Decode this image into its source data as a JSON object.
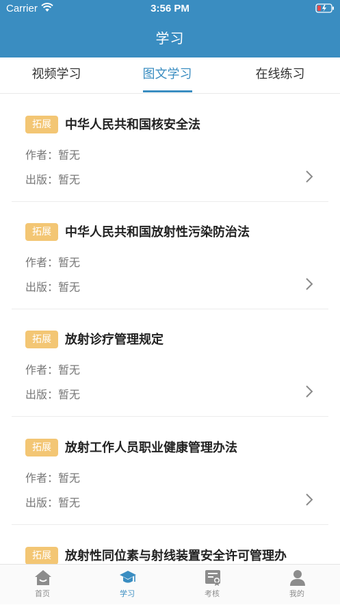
{
  "status_bar": {
    "carrier": "Carrier",
    "time": "3:56 PM"
  },
  "header": {
    "title": "学习"
  },
  "tabs": [
    {
      "label": "视频学习",
      "active": false
    },
    {
      "label": "图文学习",
      "active": true
    },
    {
      "label": "在线练习",
      "active": false
    }
  ],
  "items": [
    {
      "badge": "拓展",
      "title": "中华人民共和国核安全法",
      "author": "作者：暂无",
      "publisher": "出版：暂无"
    },
    {
      "badge": "拓展",
      "title": "中华人民共和国放射性污染防治法",
      "author": "作者：暂无",
      "publisher": "出版：暂无"
    },
    {
      "badge": "拓展",
      "title": "放射诊疗管理规定",
      "author": "作者：暂无",
      "publisher": "出版：暂无"
    },
    {
      "badge": "拓展",
      "title": "放射工作人员职业健康管理办法",
      "author": "作者：暂无",
      "publisher": "出版：暂无"
    },
    {
      "badge": "拓展",
      "title": "放射性同位素与射线装置安全许可管理办",
      "author": "",
      "publisher": ""
    }
  ],
  "tabbar": [
    {
      "label": "首页",
      "icon": "home-icon",
      "active": false
    },
    {
      "label": "学习",
      "icon": "graduation-cap-icon",
      "active": true
    },
    {
      "label": "考核",
      "icon": "certificate-icon",
      "active": false
    },
    {
      "label": "我的",
      "icon": "user-icon",
      "active": false
    }
  ],
  "colors": {
    "primary": "#3a8dc1",
    "badge": "#f3c674",
    "inactive": "#8c8c8c"
  }
}
